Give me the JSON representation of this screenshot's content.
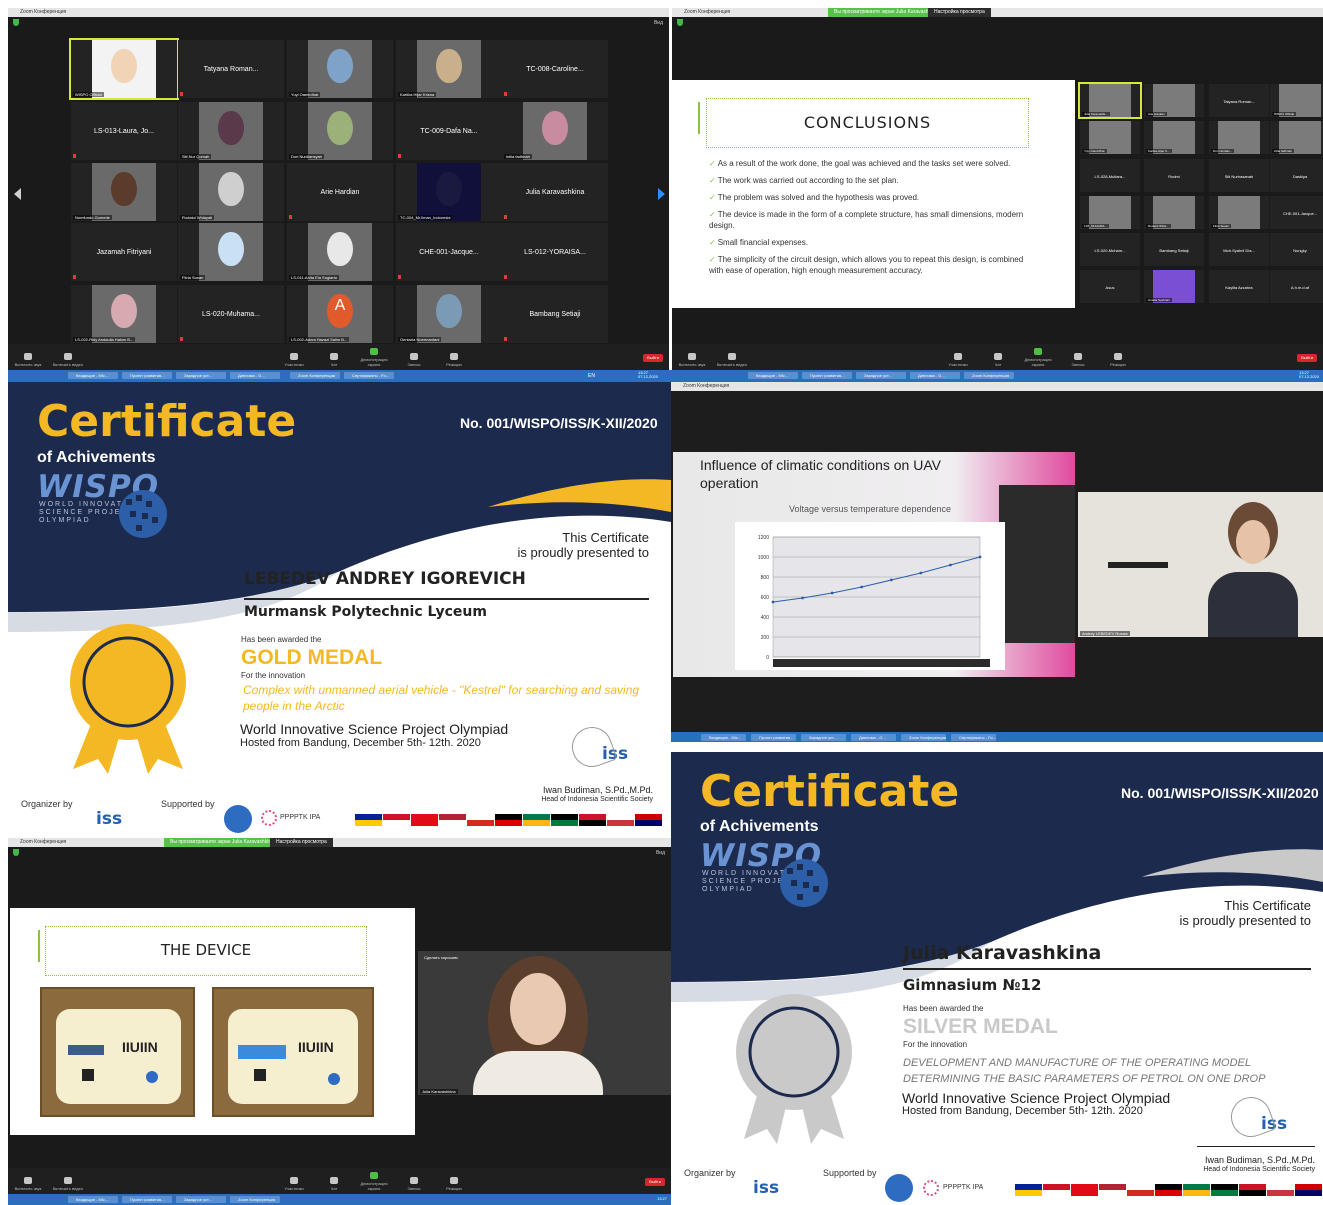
{
  "zoom": {
    "title": "Zoom Конференция",
    "view_label": "Вид",
    "viewing_banner": "Вы просматриваете экран Julia Karavashkina",
    "viewing_options": "Настройка просмотра",
    "controls": {
      "mute": "Включить звук",
      "video": "Включить видео",
      "participants": "Участники",
      "chat": "Чат",
      "share": "Демонстрация экрана",
      "record": "Запись",
      "reactions": "Реакции",
      "end": "Выйти"
    },
    "taskbar": {
      "items": [
        "Входящие - Mic...",
        "Проект развития...",
        "Зарядное уст...",
        "Диплома - G...",
        "Zoom Конференция",
        "Сертификаты - Fo..."
      ],
      "time": "13:27",
      "date": "07.12.2020",
      "lang": "EN"
    }
  },
  "gallery": {
    "participants": [
      {
        "name": "",
        "label": "WISPO Official"
      },
      {
        "name": "Tatyana Roman...",
        "label": ""
      },
      {
        "name": "",
        "label": "Yuyi Oamirdhat"
      },
      {
        "name": "",
        "label": "Kartika Hijar Krisna"
      },
      {
        "name": "TC-008-Caroline...",
        "label": ""
      },
      {
        "name": "LS-013-Laura, Jo...",
        "label": ""
      },
      {
        "name": "",
        "label": "Siti Nur Qomah"
      },
      {
        "name": "",
        "label": "Dori Nurdiansyah"
      },
      {
        "name": "TC-009-Dafa Na...",
        "label": ""
      },
      {
        "name": "",
        "label": "intlia fadhnah"
      },
      {
        "name": "",
        "label": "Nomfundo Gumede"
      },
      {
        "name": "",
        "label": "Rodatul Widayati"
      },
      {
        "name": "Arie Hardian",
        "label": ""
      },
      {
        "name": "",
        "label": "TC-004_Mr.Ilman_Indonesia"
      },
      {
        "name": "Julia Karavashkina",
        "label": ""
      },
      {
        "name": "Jazamah Fitriyani",
        "label": ""
      },
      {
        "name": "",
        "label": "Fitria Susan"
      },
      {
        "name": "",
        "label": "LS-011-Anita Ela Sugiarto"
      },
      {
        "name": "CHE-001-Jacque...",
        "label": ""
      },
      {
        "name": "LS-012-YORAISA...",
        "label": ""
      },
      {
        "name": "",
        "label": "LS-022-Ridy Andaulia Hakim B..."
      },
      {
        "name": "LS-020-Muhama...",
        "label": ""
      },
      {
        "name": "",
        "label": "LS-002-Adzra Hazazi Salim B..."
      },
      {
        "name": "",
        "label": "Oentaria Noermanfani"
      },
      {
        "name": "Bambang Setiaji",
        "label": ""
      }
    ],
    "avatar_letter": "A"
  },
  "conclusions": {
    "title": "CONCLUSIONS",
    "items": [
      "As a result of the work done, the goal was achieved and the tasks set were solved.",
      "The work was carried out according to the set plan.",
      "The problem was solved and the hypothesis was proved.",
      "The device is made in the form of a complete structure, has small dimensions, modern design.",
      "Small financial expenses.",
      "The simplicity of the circuit design, which allows you to repeat this design, is combined with ease of operation, high enough measurement accuracy."
    ],
    "sidebar": [
      "Julia Karavashk...",
      "Arie Hardian",
      "Tatyana Roman...",
      "WISPO Official",
      "Yuyi Oamirdhat",
      "Kartika Hijar K...",
      "Dori Nurdian...",
      "intlia fadhnah",
      "LS-028-Mutiara...",
      "Rodmi",
      "Siti Nurhasanah",
      "Daskiya",
      "LS5_MUHAMA...",
      "Rodatul Wida...",
      "Fitria Susan",
      "CHE-001-Jacque...",
      "LS-020-Muham...",
      "Bambang Setiaji",
      "Moh.Syahril Dia...",
      "Nungky",
      "Asus",
      "Amalia Syahrani",
      "Kayilla Azzahra",
      "A.h.m.d.af"
    ]
  },
  "cert1": {
    "title": "Certificate",
    "subtitle": "of Achivements",
    "logo": "WISPO",
    "logo_sub": [
      "WORLD INNOVATIVE",
      "SCIENCE PROJECT",
      "OLYMPIAD"
    ],
    "number": "No. 001/WISPO/ISS/K-XII/2020",
    "presented_1": "This Certificate",
    "presented_2": "is proudly presented to",
    "recipient": "LEBEDEV ANDREY IGOREVICH",
    "school": "Murmansk Polytechnic Lyceum",
    "awarded": "Has been awarded the",
    "medal": "GOLD MEDAL",
    "for_innovation": "For the innovation",
    "innovation_1": "Complex with unmanned aerial vehicle - \"Kestrel\" for searching and saving",
    "innovation_2": "people in the Arctic",
    "olympiad": "World Innovative Science Project Olympiad",
    "hosted": "Hosted from Bandung, December 5th- 12th. 2020",
    "signer": "Iwan Budiman, S.Pd.,M.Pd.",
    "signer_title": "Head of Indonesia Scientific Society",
    "organizer": "Organizer by",
    "supported": "Supported by",
    "iss": "iss",
    "partner": "PPPPTK IPA",
    "medal_color": "#f4b824"
  },
  "uav": {
    "slide_title_1": "Influence of climatic conditions on UAV",
    "slide_title_2": "operation",
    "speaker_label": "Andrey LEBEDEV Russia",
    "chart_data": {
      "type": "line",
      "title": "Voltage versus temperature dependence",
      "xlabel": "",
      "ylabel": "",
      "ylim": [
        0,
        1200
      ],
      "yticks": [
        "0",
        "200",
        "400",
        "600",
        "800",
        "1000",
        "1200"
      ],
      "x": [
        1,
        2,
        3,
        4,
        5,
        6,
        7,
        8
      ],
      "series": [
        {
          "values": [
            550,
            590,
            640,
            700,
            770,
            840,
            920,
            1000
          ]
        }
      ]
    }
  },
  "device": {
    "title": "THE DEVICE",
    "brand": "IIUIIN",
    "speaker_label": "Julia Karavashkina",
    "speaker_top": "Сделать хорошим"
  },
  "cert2": {
    "title": "Certificate",
    "subtitle": "of Achivements",
    "logo": "WISPO",
    "logo_sub": [
      "WORLD INNOVATIVE",
      "SCIENCE PROJECT",
      "OLYMPIAD"
    ],
    "number": "No. 001/WISPO/ISS/K-XII/2020",
    "presented_1": "This Certificate",
    "presented_2": "is proudly presented to",
    "recipient": "Julia Karavashkina",
    "school": "Gimnasium №12",
    "awarded": "Has been awarded the",
    "medal": "SILVER MEDAL",
    "for_innovation": "For the innovation",
    "innovation_1": "DEVELOPMENT AND MANUFACTURE OF THE OPERATING MODEL",
    "innovation_2": "DETERMINING THE BASIC PARAMETERS OF PETROL ON ONE DROP",
    "olympiad": "World Innovative Science Project Olympiad",
    "hosted": "Hosted from Bandung, December 5th- 12th. 2020",
    "signer": "Iwan Budiman, S.Pd.,M.Pd.",
    "signer_title": "Head of Indonesia Scientific Society",
    "organizer": "Organizer by",
    "supported": "Supported by",
    "iss": "iss",
    "partner": "PPPPTK IPA",
    "medal_color": "#c9c9c9"
  }
}
